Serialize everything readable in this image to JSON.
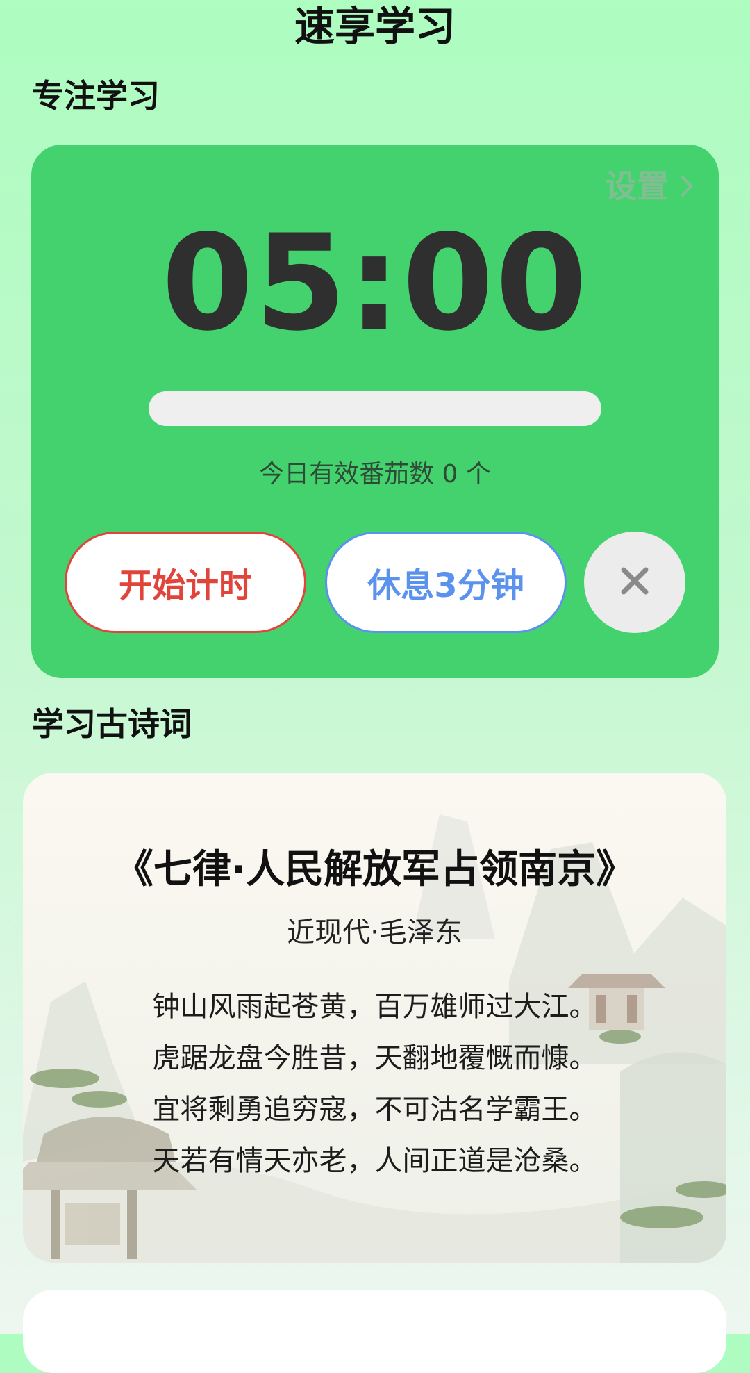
{
  "header": {
    "title": "速享学习"
  },
  "focus": {
    "section_title": "专注学习",
    "settings_label": "设置",
    "time": "05:00",
    "progress": 0,
    "today_count_text": "今日有效番茄数 0 个",
    "start_label": "开始计时",
    "rest_label": "休息3分钟"
  },
  "poetry": {
    "section_title": "学习古诗词",
    "title": "《七律·人民解放军占领南京》",
    "author": "近现代·毛泽东",
    "lines": [
      "钟山风雨起苍黄，百万雄师过大江。",
      "虎踞龙盘今胜昔，天翻地覆慨而慷。",
      "宜将剩勇追穷寇，不可沽名学霸王。",
      "天若有情天亦老，人间正道是沧桑。"
    ]
  },
  "colors": {
    "card_green": "#43d26d",
    "start_red": "#e0443b",
    "rest_blue": "#5b92ee"
  },
  "icons": {
    "settings_chevron": "chevron-right-icon",
    "close": "close-icon"
  }
}
